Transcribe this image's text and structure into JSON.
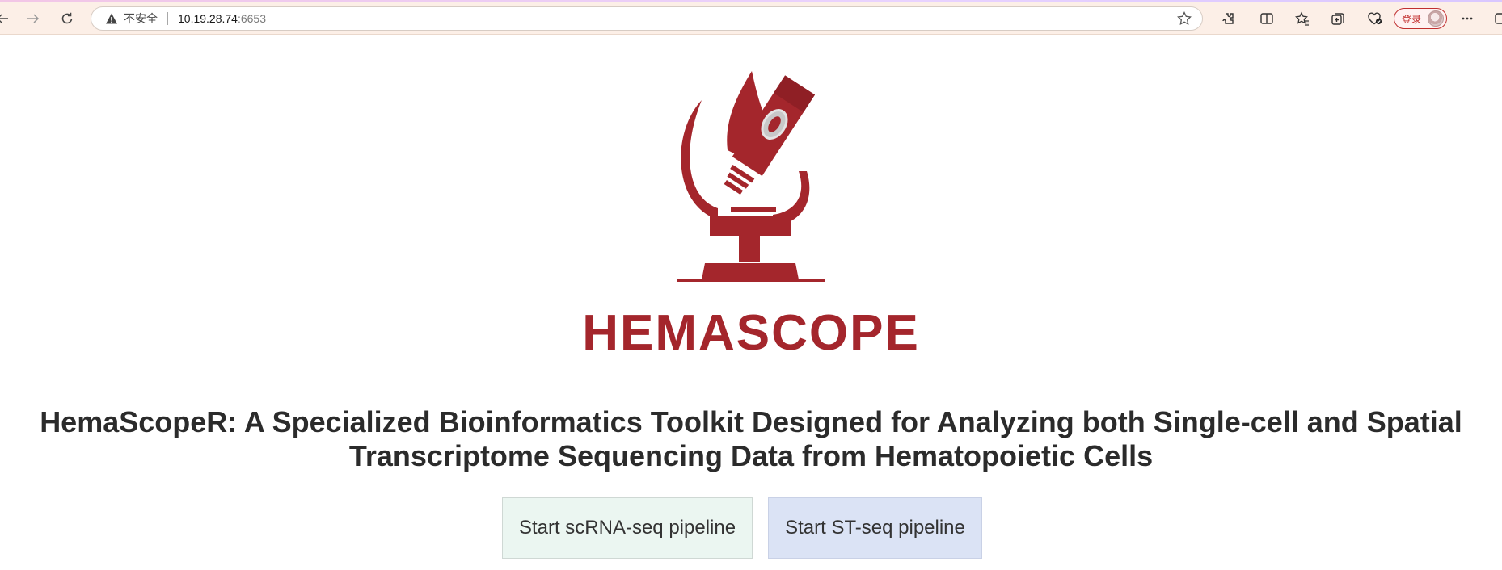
{
  "browser": {
    "insecure_label": "不安全",
    "url_host": "10.19.28.74",
    "url_port": ":6653",
    "login_label": "登录"
  },
  "page": {
    "brand_name": "HEMASCOPE",
    "headline": "HemaScopeR: A Specialized Bioinformatics Toolkit Designed for Analyzing both Single-cell and Spatial Transcriptome Sequencing Data from Hematopoietic Cells",
    "buttons": {
      "scrna_label": "Start scRNA-seq pipeline",
      "st_label": "Start ST-seq pipeline"
    }
  },
  "colors": {
    "brand": "#a4262c",
    "scrna_button_bg": "#ebf6f1",
    "st_button_bg": "#dbe3f5"
  },
  "icons": [
    "back-icon",
    "forward-icon",
    "reload-icon",
    "warning-icon",
    "star-icon",
    "extensions-icon",
    "split-screen-icon",
    "favorites-icon",
    "collections-icon",
    "browser-essentials-icon",
    "avatar",
    "more-icon",
    "copilot-icon"
  ]
}
